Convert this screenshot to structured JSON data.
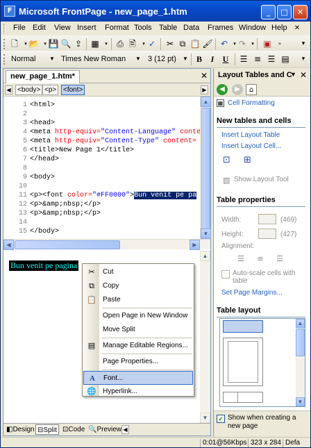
{
  "app": {
    "title": "Microsoft FrontPage - new_page_1.htm"
  },
  "menu": [
    "File",
    "Edit",
    "View",
    "Insert",
    "Format",
    "Tools",
    "Table",
    "Data",
    "Frames",
    "Window",
    "Help"
  ],
  "formatting": {
    "style": "Normal",
    "font": "Times New Roman",
    "size": "3 (12 pt)",
    "bold": "B",
    "italic": "I",
    "underline": "U"
  },
  "document": {
    "tab": "new_page_1.htm*",
    "tags": [
      "<body>",
      "<p>",
      "<font>"
    ],
    "code_lines": [
      {
        "n": "1",
        "parts": [
          [
            "t",
            "<html>"
          ]
        ]
      },
      {
        "n": "2",
        "parts": []
      },
      {
        "n": "3",
        "parts": [
          [
            "t",
            "<head>"
          ]
        ]
      },
      {
        "n": "4",
        "parts": [
          [
            "t",
            "<meta "
          ],
          [
            "a",
            "http-equiv="
          ],
          [
            "v",
            "\"Content-Language\""
          ],
          [
            "a",
            " conte"
          ]
        ]
      },
      {
        "n": "5",
        "parts": [
          [
            "t",
            "<meta "
          ],
          [
            "a",
            "http-equiv="
          ],
          [
            "v",
            "\"Content-Type\""
          ],
          [
            "a",
            " content="
          ]
        ]
      },
      {
        "n": "6",
        "parts": [
          [
            "t",
            "<title>"
          ],
          [
            "x",
            "New Page 1"
          ],
          [
            "t",
            "</title>"
          ]
        ]
      },
      {
        "n": "7",
        "parts": [
          [
            "t",
            "</head>"
          ]
        ]
      },
      {
        "n": "8",
        "parts": []
      },
      {
        "n": "9",
        "parts": [
          [
            "t",
            "<body>"
          ]
        ]
      },
      {
        "n": "10",
        "parts": []
      },
      {
        "n": "11",
        "parts": [
          [
            "t",
            "<p><font "
          ],
          [
            "a",
            "color="
          ],
          [
            "v",
            "\"#FF0000\""
          ],
          [
            "t",
            ">"
          ],
          [
            "s",
            "Bun venit pe pa"
          ]
        ]
      },
      {
        "n": "12",
        "parts": [
          [
            "t",
            "<p>"
          ],
          [
            "x",
            "&amp;nbsp;"
          ],
          [
            "t",
            "</p>"
          ]
        ]
      },
      {
        "n": "13",
        "parts": [
          [
            "t",
            "<p>"
          ],
          [
            "x",
            "&amp;nbsp;"
          ],
          [
            "t",
            "</p>"
          ]
        ]
      },
      {
        "n": "14",
        "parts": []
      },
      {
        "n": "15",
        "parts": [
          [
            "t",
            "</body>"
          ]
        ]
      }
    ],
    "design_text": "Bun venit pe pagina",
    "view_tabs": [
      "Design",
      "Split",
      "Code",
      "Preview"
    ]
  },
  "context_menu": {
    "items": [
      {
        "label": "Cut",
        "icon": "scissors-icon",
        "glyph": "✂"
      },
      {
        "label": "Copy",
        "icon": "copy-icon",
        "glyph": "⧉"
      },
      {
        "label": "Paste",
        "icon": "paste-icon",
        "glyph": "📋"
      },
      {
        "sep": true
      },
      {
        "label": "Open Page in New Window",
        "icon": "",
        "glyph": ""
      },
      {
        "label": "Move Split",
        "icon": "",
        "glyph": ""
      },
      {
        "sep": true
      },
      {
        "label": "Manage Editable Regions...",
        "icon": "editable-regions-icon",
        "glyph": "▤"
      },
      {
        "sep": true
      },
      {
        "label": "Page Properties...",
        "icon": "",
        "glyph": ""
      },
      {
        "sep": true
      },
      {
        "label": "Font...",
        "icon": "font-icon",
        "glyph": "A",
        "highlighted": true
      },
      {
        "label": "Hyperlink...",
        "icon": "hyperlink-icon",
        "glyph": "🌐"
      }
    ]
  },
  "task_pane": {
    "title": "Layout Tables and C",
    "cell_formatting": "Cell Formatting",
    "new_section": "New tables and cells",
    "insert_table": "Insert Layout Table",
    "insert_cell": "Insert Layout Cell...",
    "show_tool": "Show Layout Tool",
    "props_section": "Table properties",
    "width_label": "Width:",
    "width_value": "(469)",
    "height_label": "Height:",
    "height_value": "(427)",
    "alignment_label": "Alignment:",
    "autoscale": "Auto-scale cells with table",
    "margins": "Set Page Margins...",
    "layout_section": "Table layout",
    "show_when": "Show when creating a new page"
  },
  "status": {
    "speed": "0:01@56Kbps",
    "dims": "323 x 284",
    "mode": "Defa"
  }
}
